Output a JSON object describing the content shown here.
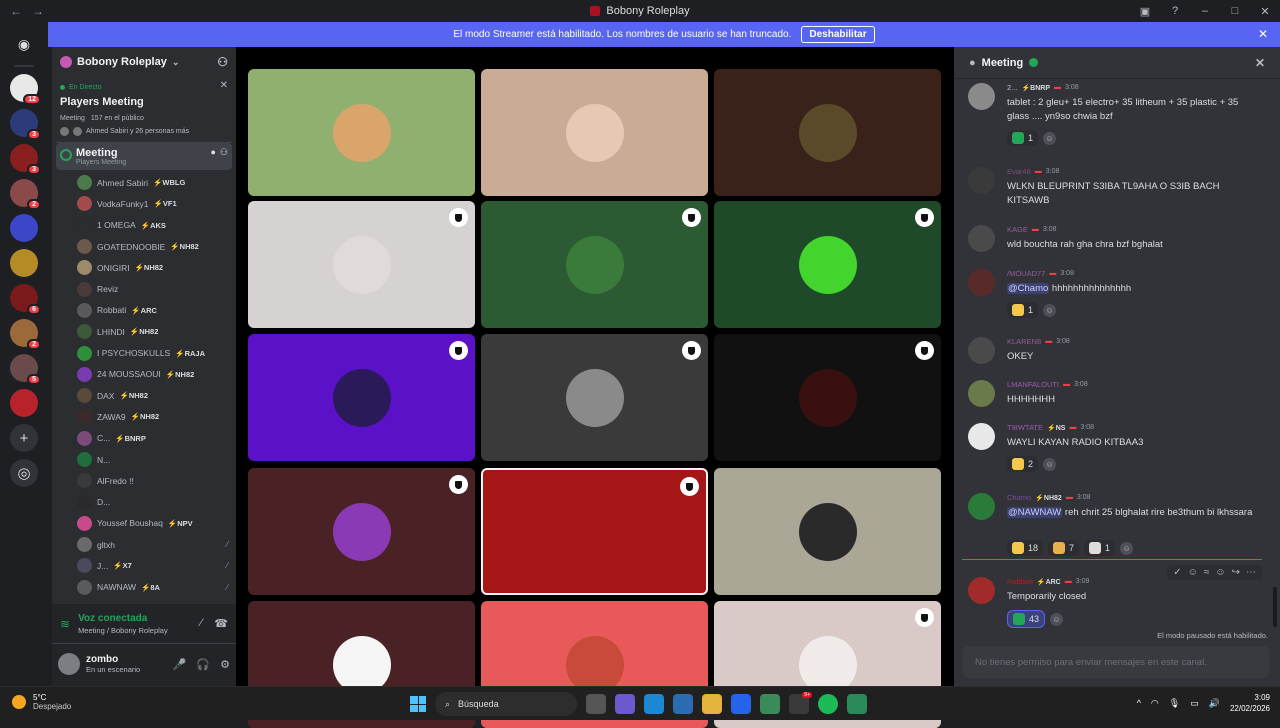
{
  "window": {
    "title": "Bobony Roleplay",
    "controls": [
      "minimize",
      "maximize",
      "close"
    ]
  },
  "banner": {
    "text": "El modo Streamer está habilitado. Los nombres de usuario se han truncado.",
    "button": "Deshabilitar"
  },
  "guilds": [
    {
      "name": "discord-home"
    },
    {
      "name": "guild-1",
      "badge": "12",
      "color": "#e8e8e8"
    },
    {
      "name": "guild-2",
      "badge": "3",
      "color": "#2d3b7a"
    },
    {
      "name": "guild-3",
      "badge": "3",
      "color": "#8a1f1f"
    },
    {
      "name": "guild-4",
      "badge": "2",
      "color": "#8a4a4a"
    },
    {
      "name": "guild-5",
      "badge": "",
      "color": "#3b46c9"
    },
    {
      "name": "guild-6",
      "badge": "",
      "color": "#b58b26"
    },
    {
      "name": "guild-7",
      "badge": "6",
      "color": "#7a1a1a"
    },
    {
      "name": "guild-8",
      "badge": "2",
      "color": "#9c6a3a"
    },
    {
      "name": "guild-9",
      "badge": "5",
      "color": "#6a4a4a"
    },
    {
      "name": "guild-10",
      "badge": "",
      "color": "#b8222b"
    }
  ],
  "sidebar": {
    "server_name": "Bobony Roleplay",
    "event": {
      "status": "En Directo",
      "title": "Players Meeting",
      "channel": "Meeting",
      "audience": "157 en el público",
      "people": "Ahmed Sabiri y 26 personas más"
    },
    "channel": {
      "name": "Meeting",
      "subtitle": "Players Meeting"
    },
    "users": [
      {
        "name": "Ahmed Sabiri",
        "tag": "WBLG",
        "color": "#4d7a4a"
      },
      {
        "name": "VodkaFunky1",
        "tag": "VF1",
        "color": "#a34a4a"
      },
      {
        "name": "1 OMEGA",
        "tag": "AKS",
        "color": "#2b2d31"
      },
      {
        "name": "GOATEDNOOBIE",
        "tag": "NH82",
        "color": "#6b5a4a"
      },
      {
        "name": "ONIGIRI",
        "tag": "NH82",
        "color": "#9c8a6a"
      },
      {
        "name": "Reviz",
        "tag": "",
        "color": "#4a3a3a"
      },
      {
        "name": "Robbati",
        "tag": "ARC",
        "color": "#5a5a5a"
      },
      {
        "name": "LHINDI",
        "tag": "NH82",
        "color": "#3a5a3a"
      },
      {
        "name": "I PSYCHOSKULLS",
        "tag": "RAJA",
        "color": "#2f8f3a"
      },
      {
        "name": "24 MOUSSAOUI",
        "tag": "NH82",
        "color": "#7a3ab0"
      },
      {
        "name": "DAX",
        "tag": "NH82",
        "color": "#5a4a3a"
      },
      {
        "name": "ZAWA9",
        "tag": "NH82",
        "color": "#3a2a2a"
      },
      {
        "name": "C...",
        "tag": "BNRP",
        "color": "#7a4a7a"
      },
      {
        "name": "N...",
        "tag": "",
        "color": "#1f6f3a"
      },
      {
        "name": "AlFredo !!",
        "tag": "",
        "color": "#3a3a3a"
      },
      {
        "name": "D...",
        "tag": "",
        "color": "#2a2a2a"
      },
      {
        "name": "Youssef Boushaq",
        "tag": "NPV",
        "color": "#c94a8a"
      },
      {
        "name": "gltxh",
        "tag": "",
        "color": "#6a6a6a"
      },
      {
        "name": "J...",
        "tag": "X7",
        "color": "#4a4a5a"
      },
      {
        "name": "NAWNAW",
        "tag": "8A",
        "color": "#5a5a5a"
      }
    ]
  },
  "voice": {
    "status": "Voz conectada",
    "location": "Meeting / Bobony Roleplay",
    "username": "zombo",
    "user_status": "En un escenario"
  },
  "stage_tiles": [
    {
      "bg": "#8fb06e",
      "av": "#d9a56b",
      "shield": false
    },
    {
      "bg": "#c9ab96",
      "av": "#e5c9b4",
      "shield": false
    },
    {
      "bg": "#3a2119",
      "av": "#5a4a2a",
      "shield": false
    },
    {
      "bg": "#d5d2d1",
      "av": "#e0dada",
      "shield": true
    },
    {
      "bg": "#2c5a33",
      "av": "#3a7a3a",
      "shield": true
    },
    {
      "bg": "#1f4a2a",
      "av": "#43d42e",
      "shield": true
    },
    {
      "bg": "#5b11c7",
      "av": "#2a1a5a",
      "shield": true
    },
    {
      "bg": "#3a3a3a",
      "av": "#8a8a8a",
      "shield": true
    },
    {
      "bg": "#111111",
      "av": "#3a0f0f",
      "shield": true
    },
    {
      "bg": "#4a2226",
      "av": "#8a3ab5",
      "shield": true
    },
    {
      "bg": "#a51616",
      "av": "#a51616",
      "shield": true,
      "selected": true
    },
    {
      "bg": "#aaa796",
      "av": "#2a2a2a",
      "shield": false
    },
    {
      "bg": "#4a2226",
      "av": "#f5f5f5",
      "shield": false
    },
    {
      "bg": "#e85a5a",
      "av": "#c94a3a",
      "shield": false
    },
    {
      "bg": "#d9c9c7",
      "av": "#f0ebe9",
      "shield": true
    }
  ],
  "chat": {
    "channel": "Meeting",
    "messages": [
      {
        "user": "2...",
        "ucolor": "#c7ccd1",
        "tag": "BNRP",
        "time": "3:08",
        "av": "#8a8a8a",
        "text": "tablet : 2 gleu+ 15 electro+ 35 litheum + 35 plastic + 35 glass .... yn9so chwia bzf",
        "reactions": [
          {
            "c": "#23a55a",
            "n": "1"
          }
        ]
      },
      {
        "user": "Evar48",
        "ucolor": "#7a4a7a",
        "tag": "",
        "time": "3:08",
        "av": "#3a3a3a",
        "text": "WLKN BLEUPRINT S3IBA TL9AHA O S3IB BACH KITSAWB",
        "reactions": []
      },
      {
        "user": "KAGE",
        "ucolor": "#9a5a9a",
        "tag": "",
        "time": "3:08",
        "av": "#4a4a4a",
        "text": "wld bouchta rah gha chra bzf bghalat",
        "reactions": []
      },
      {
        "user": "/MOUAD77",
        "ucolor": "#9a5a9a",
        "tag": "",
        "time": "3:08",
        "av": "#5a2a2a",
        "mention": "@Chamo",
        "text": "hhhhhhhhhhhhhhh",
        "reactions": [
          {
            "c": "#f2c94c",
            "n": "1"
          }
        ]
      },
      {
        "user": "KLAREN8",
        "ucolor": "#9a5a9a",
        "tag": "",
        "time": "3:08",
        "av": "#4a4a4a",
        "text": "OKEY",
        "reactions": []
      },
      {
        "user": "LMANFALOUTI",
        "ucolor": "#a05ab0",
        "tag": "",
        "time": "3:08",
        "av": "#6a7a4a",
        "text": "HHHHHHH",
        "reactions": []
      },
      {
        "user": "T9IWTATE",
        "ucolor": "#a05ab0",
        "tag": "NS",
        "time": "3:08",
        "av": "#e8e8e8",
        "text": "WAYLI KAYAN RADIO KITBAA3",
        "reactions": [
          {
            "c": "#f2c94c",
            "n": "2"
          }
        ]
      },
      {
        "user": "Chamo",
        "ucolor": "#7a4a9a",
        "tag": "NH82",
        "time": "3:08",
        "av": "#2a7a3a",
        "mention": "@NAWNAW",
        "text": "reh chrit 25 blghalat rire be3thum bi lkhssara",
        "reactions": [
          {
            "c": "#f2c94c",
            "n": "18"
          },
          {
            "c": "#e8b04c",
            "n": "7"
          },
          {
            "c": "#ddd",
            "n": "1"
          }
        ]
      },
      {
        "user": "Robbati",
        "ucolor": "#c01a1a",
        "tag": "ARC",
        "time": "3:09",
        "av": "#a12a2a",
        "text": "Temporarily closed",
        "reactions": [
          {
            "c": "#23a55a",
            "n": "43",
            "on": true
          }
        ]
      }
    ],
    "paused": "El modo pausado está habilitado.",
    "composer_placeholder": "No tienes permiso para enviar mensajes en este canal."
  },
  "taskbar": {
    "weather_temp": "5°C",
    "weather_desc": "Despejado",
    "search": "Búsqueda",
    "time": "3:09",
    "date": "22/02/2026"
  }
}
